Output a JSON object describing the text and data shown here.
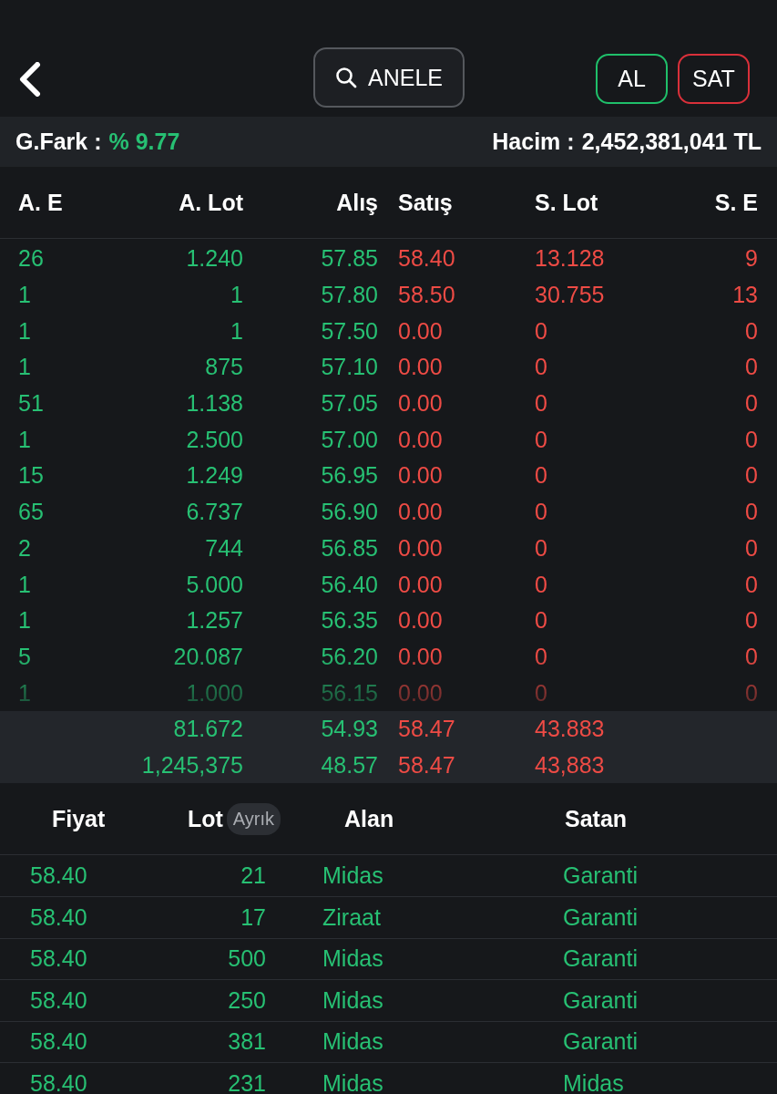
{
  "header": {
    "search": {
      "value": "ANELE"
    },
    "buttons": [
      {
        "label": "AL",
        "kind": "buy"
      },
      {
        "label": "SAT",
        "kind": "sell"
      }
    ]
  },
  "summary": {
    "change_label": "G.Fark :",
    "change_value": "% 9.77",
    "volume_label": "Hacim :",
    "volume_value": "2,452,381,041 TL"
  },
  "depth": {
    "columns": [
      "A. E",
      "A. Lot",
      "Alış",
      "Satış",
      "S. Lot",
      "S. E"
    ],
    "rows": [
      [
        "26",
        "1.240",
        "57.85",
        "58.40",
        "13.128",
        "9"
      ],
      [
        "1",
        "1",
        "57.80",
        "58.50",
        "30.755",
        "13"
      ],
      [
        "1",
        "1",
        "57.50",
        "0.00",
        "0",
        "0"
      ],
      [
        "1",
        "875",
        "57.10",
        "0.00",
        "0",
        "0"
      ],
      [
        "51",
        "1.138",
        "57.05",
        "0.00",
        "0",
        "0"
      ],
      [
        "1",
        "2.500",
        "57.00",
        "0.00",
        "0",
        "0"
      ],
      [
        "15",
        "1.249",
        "56.95",
        "0.00",
        "0",
        "0"
      ],
      [
        "65",
        "6.737",
        "56.90",
        "0.00",
        "0",
        "0"
      ],
      [
        "2",
        "744",
        "56.85",
        "0.00",
        "0",
        "0"
      ],
      [
        "1",
        "5.000",
        "56.40",
        "0.00",
        "0",
        "0"
      ],
      [
        "1",
        "1.257",
        "56.35",
        "0.00",
        "0",
        "0"
      ],
      [
        "5",
        "20.087",
        "56.20",
        "0.00",
        "0",
        "0"
      ],
      [
        "1",
        "1.000",
        "56.15",
        "0.00",
        "0",
        "0"
      ]
    ],
    "totals": [
      [
        "81.672",
        "54.93",
        "58.47",
        "43.883"
      ],
      [
        "1,245,375",
        "48.57",
        "58.47",
        "43,883"
      ]
    ]
  },
  "trades": {
    "columns": [
      "Fiyat",
      "Lot",
      "Alan",
      "Satan"
    ],
    "lot_toggle": "Ayrık",
    "rows": [
      [
        "58.40",
        "21",
        "Midas",
        "Garanti"
      ],
      [
        "58.40",
        "17",
        "Ziraat",
        "Garanti"
      ],
      [
        "58.40",
        "500",
        "Midas",
        "Garanti"
      ],
      [
        "58.40",
        "250",
        "Midas",
        "Garanti"
      ],
      [
        "58.40",
        "381",
        "Midas",
        "Garanti"
      ],
      [
        "58.40",
        "231",
        "Midas",
        "Midas"
      ]
    ]
  }
}
